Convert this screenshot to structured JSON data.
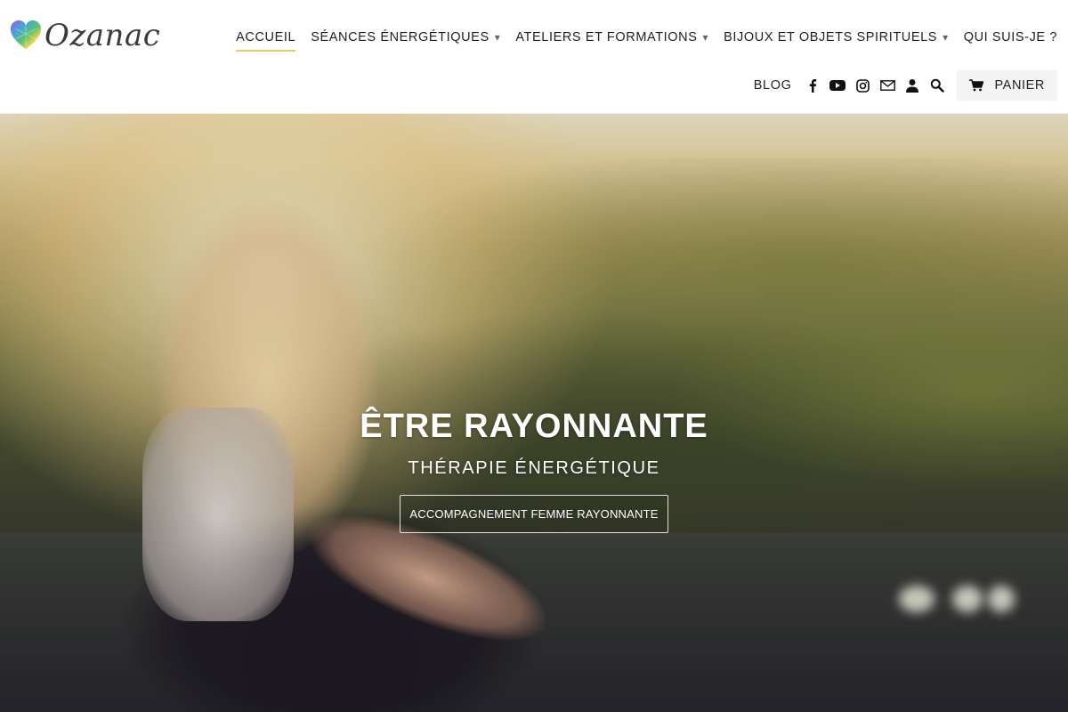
{
  "brand": {
    "name": "Ozanac"
  },
  "nav": {
    "items": [
      {
        "label": "ACCUEIL",
        "active": true,
        "has_dropdown": false
      },
      {
        "label": "SÉANCES ÉNERGÉTIQUES",
        "active": false,
        "has_dropdown": true
      },
      {
        "label": "ATELIERS ET FORMATIONS",
        "active": false,
        "has_dropdown": true
      },
      {
        "label": "BIJOUX ET OBJETS SPIRITUELS",
        "active": false,
        "has_dropdown": true
      },
      {
        "label": "QUI SUIS-JE ?",
        "active": false,
        "has_dropdown": false
      }
    ],
    "dropdown_glyph": "▾"
  },
  "secondary_nav": {
    "blog_label": "BLOG",
    "icons": [
      "facebook-icon",
      "youtube-icon",
      "instagram-icon",
      "mail-icon",
      "account-icon",
      "search-icon"
    ],
    "cart_label": "PANIER"
  },
  "hero": {
    "title": "ÊTRE RAYONNANTE",
    "subtitle": "THÉRAPIE ÉNERGÉTIQUE",
    "button_label": "ACCOMPAGNEMENT FEMME RAYONNANTE"
  },
  "colors": {
    "accent_underline": "#e9c86a",
    "text": "#222222",
    "cart_background": "#f4f4f4"
  }
}
